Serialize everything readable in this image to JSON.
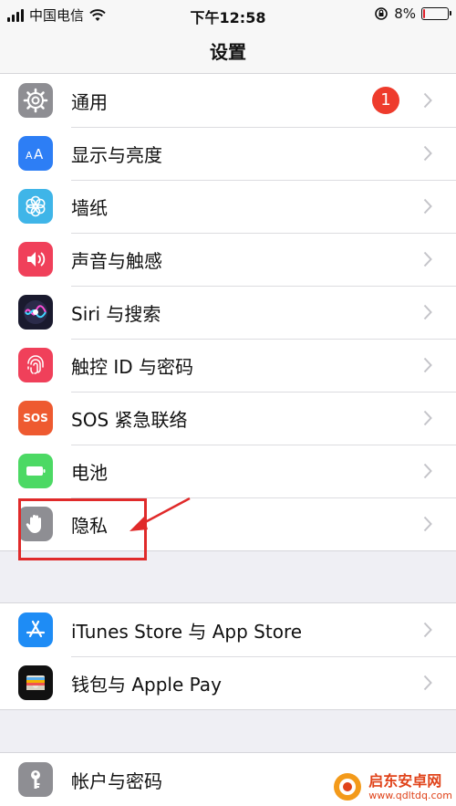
{
  "status_bar": {
    "carrier": "中国电信",
    "time": "下午12:58",
    "battery_percent": "8%",
    "battery_level": 0.08
  },
  "nav": {
    "title": "设置"
  },
  "groups": [
    {
      "items": [
        {
          "label": "通用",
          "icon": "gear-icon",
          "icon_bg": "#8e8e93",
          "badge": "1"
        },
        {
          "label": "显示与亮度",
          "icon": "text-size-icon",
          "icon_bg": "#2d7ef5"
        },
        {
          "label": "墙纸",
          "icon": "flower-icon",
          "icon_bg": "#3fb5e8"
        },
        {
          "label": "声音与触感",
          "icon": "speaker-icon",
          "icon_bg": "#f0405a"
        },
        {
          "label": "Siri 与搜索",
          "icon": "siri-icon",
          "icon_bg": "#1a1a2e"
        },
        {
          "label": "触控 ID 与密码",
          "icon": "fingerprint-icon",
          "icon_bg": "#f0405a"
        },
        {
          "label": "SOS 紧急联络",
          "icon": "sos-icon",
          "icon_bg": "#ee5a30",
          "icon_text": "SOS"
        },
        {
          "label": "电池",
          "icon": "battery-icon",
          "icon_bg": "#4cd964"
        },
        {
          "label": "隐私",
          "icon": "hand-icon",
          "icon_bg": "#8e8e93"
        }
      ]
    },
    {
      "items": [
        {
          "label": "iTunes Store 与 App Store",
          "icon": "app-store-icon",
          "icon_bg": "#1e8cf5"
        },
        {
          "label": "钱包与 Apple Pay",
          "icon": "wallet-icon",
          "icon_bg": "#111111"
        }
      ]
    },
    {
      "items": [
        {
          "label": "帐户与密码",
          "icon": "key-icon",
          "icon_bg": "#8e8e93"
        }
      ]
    }
  ],
  "annotation": {
    "color": "#e02a2a"
  },
  "watermark": {
    "brand": "启东安卓网",
    "site": "www.qdltdq.com"
  }
}
